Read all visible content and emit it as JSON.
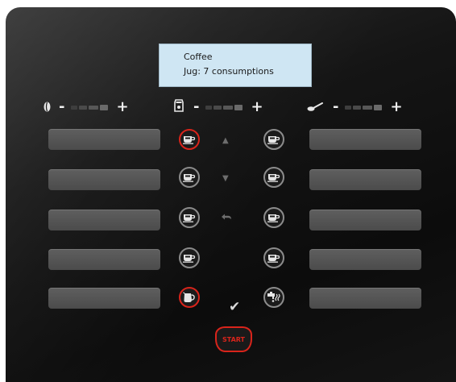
{
  "display": {
    "line1": "Coffee",
    "line2": "Jug: 7 consumptions"
  },
  "controls": {
    "bean": {
      "icon": "coffee-bean-icon",
      "minus": "-",
      "plus": "+"
    },
    "powder": {
      "icon": "ground-coffee-icon",
      "minus": "-",
      "plus": "+"
    },
    "milk": {
      "icon": "milk-spoon-icon",
      "minus": "-",
      "plus": "+"
    }
  },
  "start_label": "START",
  "colors": {
    "accent_red": "#d9241b",
    "display_bg": "#cfe6f3",
    "panel_bg": "#111111",
    "slot_bg": "#555555"
  },
  "icons": {
    "cup": "coffee-cup-icon",
    "jug": "jug-icon",
    "hot_water": "hot-water-icon",
    "up": "arrow-up-icon",
    "down": "arrow-down-icon",
    "back": "back-arrow-icon",
    "confirm": "checkmark-icon"
  }
}
